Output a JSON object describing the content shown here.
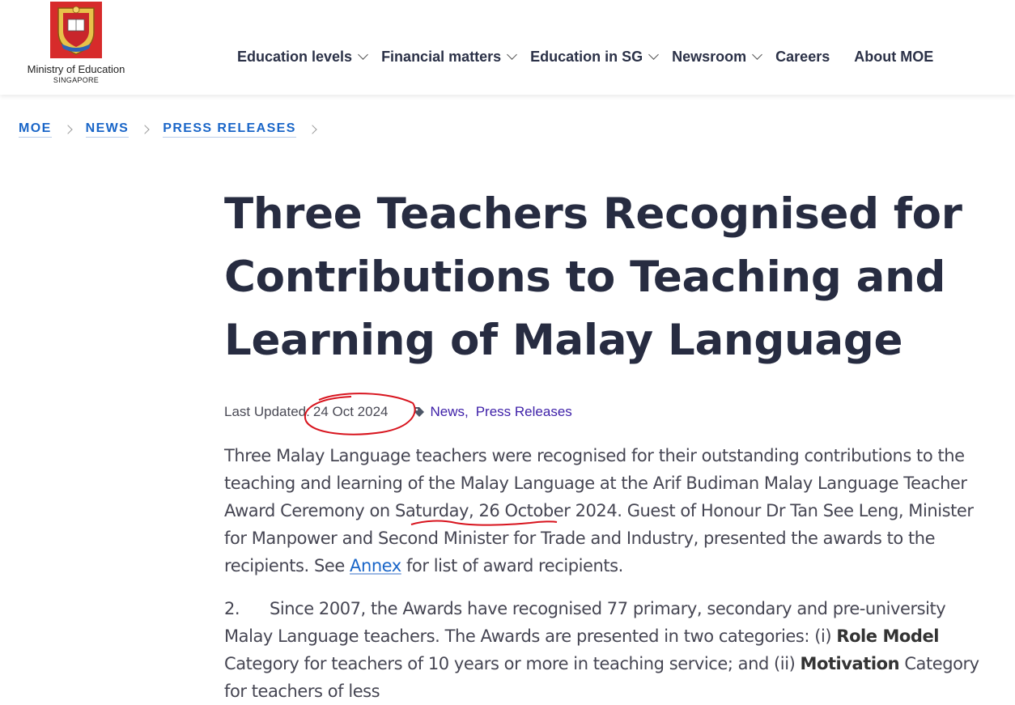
{
  "header": {
    "logo": {
      "name": "Ministry of Education",
      "sub": "SINGAPORE"
    },
    "nav": [
      {
        "label": "Education levels",
        "dropdown": true
      },
      {
        "label": "Financial matters",
        "dropdown": true
      },
      {
        "label": "Education in SG",
        "dropdown": true
      },
      {
        "label": "Newsroom",
        "dropdown": true
      },
      {
        "label": "Careers",
        "dropdown": false
      },
      {
        "label": "About MOE",
        "dropdown": false
      }
    ]
  },
  "breadcrumb": [
    "MOE",
    "NEWS",
    "PRESS RELEASES"
  ],
  "article": {
    "title": "Three Teachers Recognised for Contributions to Teaching and Learning of Malay Language",
    "last_updated_label": "Last Updated:",
    "last_updated_date": "24 Oct 2024",
    "tags": [
      "News,",
      "Press Releases"
    ],
    "p1_a": "Three Malay Language teachers were recognised for their outstanding contributions to the teaching and learning of the Malay Language at the Arif Budiman Malay Language Teacher Award Ceremony on Saturday, 26 October 2024. Guest of Honour Dr Tan See Leng, Minister for Manpower and Second Minister for Trade and Industry, presented the awards to the recipients. See ",
    "p1_link": "Annex",
    "p1_b": " for list of award recipients.",
    "p2_num": "2.",
    "p2_a": "Since 2007, the Awards have recognised 77 primary, secondary and pre-university Malay Language teachers. The Awards are presented in two categories: (i) ",
    "p2_bold1": "Role Model",
    "p2_b": " Category for teachers of 10 years or more in teaching service; and (ii) ",
    "p2_bold2": "Motivation",
    "p2_c": " Category for teachers of less"
  },
  "colors": {
    "link": "#1a66c8",
    "tag_link": "#3d1fa8",
    "title": "#272c41",
    "annotation": "#d8141e"
  }
}
